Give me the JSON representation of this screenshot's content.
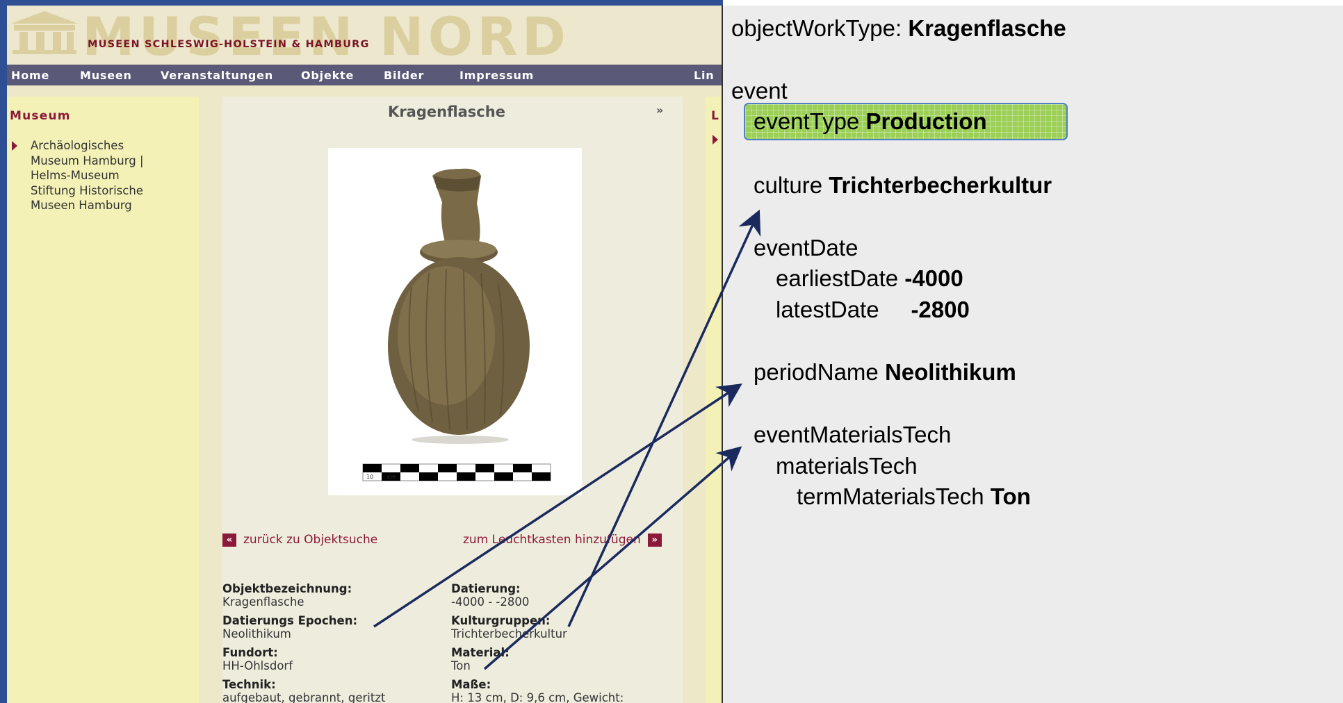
{
  "site": {
    "logo_word": "MUSEEN NORD",
    "logo_subtitle": "MUSEEN SCHLESWIG-HOLSTEIN & HAMBURG",
    "nav": [
      "Home",
      "Museen",
      "Veranstaltungen",
      "Objekte",
      "Bilder",
      "Impressum",
      "Lin"
    ],
    "left_column": {
      "title": "Museum",
      "museum_link": "Archäologisches\nMuseum Hamburg |\nHelms-Museum\nStiftung Historische\nMuseen Hamburg"
    },
    "right_column_letter": "L",
    "object": {
      "title": "Kragenflasche",
      "expand": "»",
      "back_link": "zurück zu Objektsuche",
      "add_link": "zum Leuchtkasten hinzufügen",
      "back_arrow": "«",
      "add_arrow": "»",
      "scale_labels": [
        "10",
        "cm"
      ],
      "details": {
        "objektbezeichnung_label": "Objektbezeichnung:",
        "objektbezeichnung_value": "Kragenflasche",
        "datierung_label": "Datierung:",
        "datierung_value": "-4000 - -2800",
        "epochen_label": "Datierungs Epochen:",
        "epochen_value": "Neolithikum",
        "kulturgruppen_label": "Kulturgruppen:",
        "kulturgruppen_value": "Trichterbecherkultur",
        "fundort_label": "Fundort:",
        "fundort_value": "HH-Ohlsdorf",
        "material_label": "Material:",
        "material_value": "Ton",
        "technik_label": "Technik:",
        "technik_value": "aufgebaut, gebrannt, geritzt",
        "masse_label": "Maße:",
        "masse_value": "H: 13 cm, D: 9,6 cm, Gewicht:"
      }
    }
  },
  "panel": {
    "object_work_type_key": "objectWorkType: ",
    "object_work_type_value": "Kragenflasche",
    "event": "event",
    "event_type_key": "eventType ",
    "event_type_value": "Production",
    "culture_key": "culture ",
    "culture_value": "Trichterbecherkultur",
    "event_date": "eventDate",
    "earliest_key": "earliestDate ",
    "earliest_value": "-4000",
    "latest_key": "latestDate     ",
    "latest_value": "-2800",
    "period_key": "periodName ",
    "period_value": "Neolithikum",
    "materials_tech_group": "eventMaterialsTech",
    "materials_tech": "materialsTech",
    "term_key": "termMaterialsTech ",
    "term_value": "Ton"
  },
  "colors": {
    "arrow": "#1b2a5e",
    "highlight_fill": "#9bcf56",
    "highlight_border": "#4f80c0",
    "accent_red": "#8b1a3a",
    "nav_bg": "#5a5a78"
  }
}
